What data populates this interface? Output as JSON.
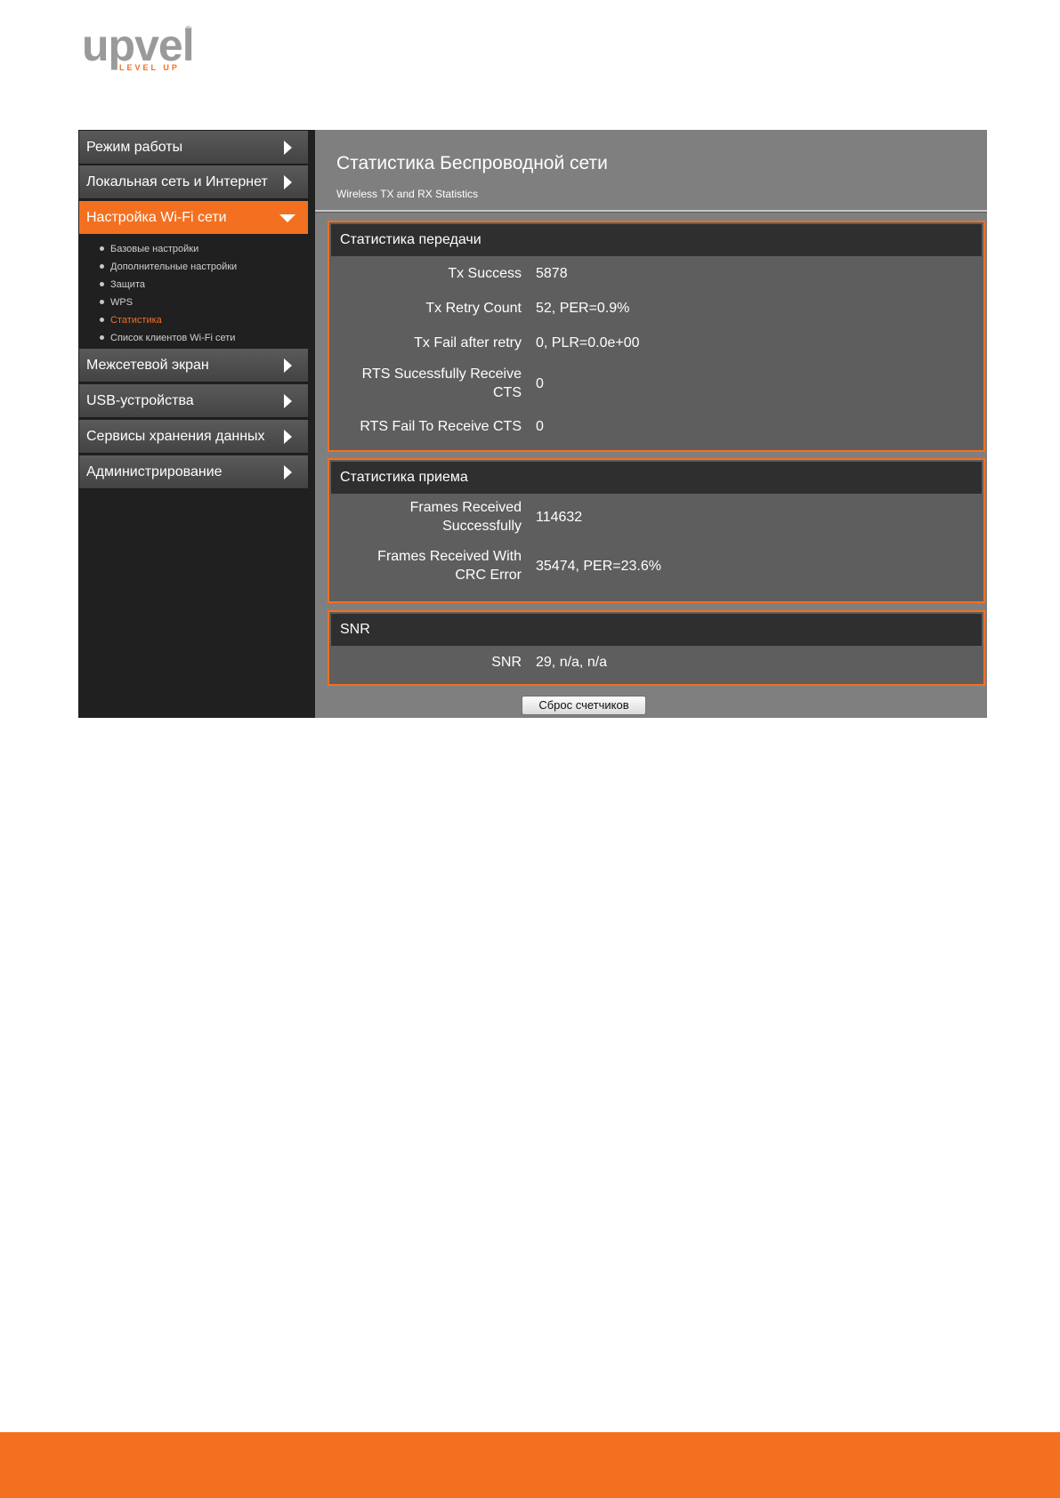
{
  "logo": {
    "main": "upvel",
    "registered": "®",
    "tagline": "LEVEL UP"
  },
  "sidebar": {
    "items": [
      {
        "label": "Режим работы"
      },
      {
        "label": "Локальная сеть и Интернет"
      },
      {
        "label": "Настройка Wi-Fi сети"
      },
      {
        "label": "Межсетевой экран"
      },
      {
        "label": "USB-устройства"
      },
      {
        "label": "Сервисы хранения данных"
      },
      {
        "label": "Администрирование"
      }
    ],
    "wifi_subitems": [
      {
        "label": "Базовые настройки"
      },
      {
        "label": "Дополнительные настройки"
      },
      {
        "label": "Защита"
      },
      {
        "label": "WPS"
      },
      {
        "label": "Статистика"
      },
      {
        "label": "Список клиентов Wi-Fi сети"
      }
    ]
  },
  "main": {
    "title": "Статистика Беспроводной сети",
    "subtitle": "Wireless TX and RX Statistics",
    "tx": {
      "heading": "Статистика передачи",
      "rows": [
        {
          "label": "Tx Success",
          "value": "5878"
        },
        {
          "label": "Tx Retry Count",
          "value": "52, PER=0.9%"
        },
        {
          "label": "Tx Fail after retry",
          "value": "0, PLR=0.0e+00"
        },
        {
          "label_line1": "RTS Sucessfully Receive",
          "label_line2": "CTS",
          "value": "0"
        },
        {
          "label": "RTS Fail To Receive CTS",
          "value": "0"
        }
      ]
    },
    "rx": {
      "heading": "Статистика приема",
      "rows": [
        {
          "label_line1": "Frames Received",
          "label_line2": "Successfully",
          "value": "114632"
        },
        {
          "label_line1": "Frames Received With",
          "label_line2": "CRC Error",
          "value": "35474, PER=23.6%"
        }
      ]
    },
    "snr": {
      "heading": "SNR",
      "rows": [
        {
          "label": "SNR",
          "value": "29, n/a, n/a"
        }
      ]
    },
    "reset_button": "Сброс счетчиков"
  },
  "colors": {
    "accent": "#f37021",
    "sidebar_bg": "#202020",
    "content_bg": "#7f7f7f",
    "panel_bg": "#5e5e5e"
  }
}
